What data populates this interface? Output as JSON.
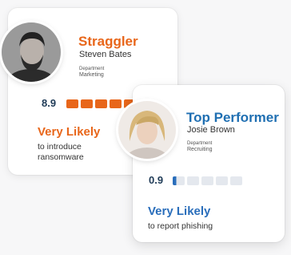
{
  "straggler": {
    "title": "Straggler",
    "name": "Steven Bates",
    "department_label": "Department",
    "department": "Marketing",
    "score": "8.9",
    "risk_level": 0.9,
    "likelihood": "Very Likely",
    "description_line1": "to introduce",
    "description_line2": "ransomware",
    "accent_color": "#e8661a",
    "likely_color": "#e8661a"
  },
  "top_performer": {
    "title": "Top Performer",
    "name": "Josie Brown",
    "department_label": "Department",
    "department": "Recruiting",
    "score": "0.9",
    "risk_level": 0.1,
    "likelihood": "Very Likely",
    "description": "to report phishing",
    "accent_color": "#1f6fb2",
    "likely_color": "#2a6ebb"
  }
}
